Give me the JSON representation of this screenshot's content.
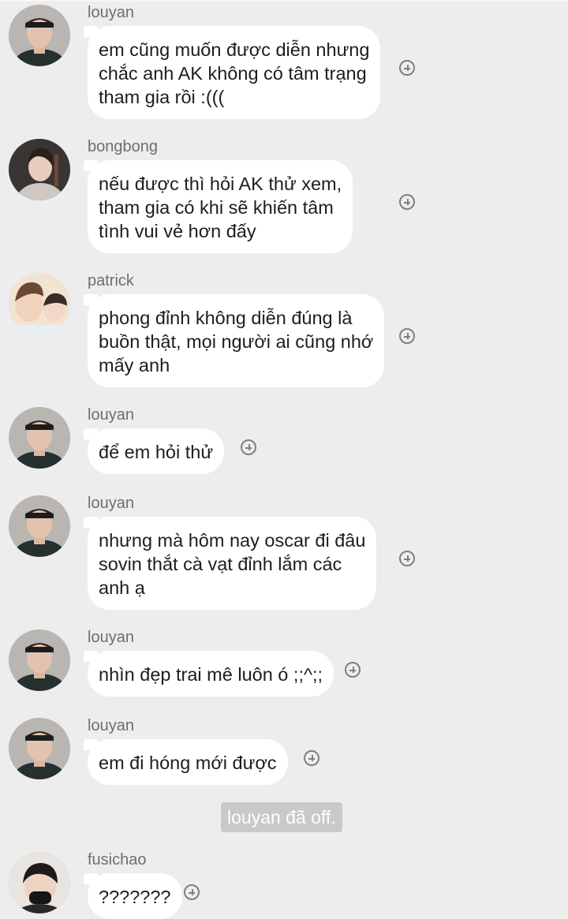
{
  "messages": [
    {
      "sender": "louyan",
      "avatar": "louyan-avatar",
      "text": "em cũng muốn được diễn nhưng\nchắc anh AK không có tâm trạng\ntham gia rồi :((("
    },
    {
      "sender": "bongbong",
      "avatar": "bongbong-avatar",
      "text": "nếu được thì hỏi AK thử xem,\ntham gia có khi sẽ khiến tâm\ntình vui vẻ hơn đấy"
    },
    {
      "sender": "patrick",
      "avatar": "patrick-avatar",
      "text": "phong đỉnh không diễn đúng là\nbuồn thật, mọi người ai cũng nhớ\nmấy anh"
    },
    {
      "sender": "louyan",
      "avatar": "louyan-avatar",
      "text": "để em hỏi thử"
    },
    {
      "sender": "louyan",
      "avatar": "louyan-avatar",
      "text": "nhưng mà hôm nay oscar đi đâu\nsovin thắt cà vạt đỉnh lắm các\nanh ạ"
    },
    {
      "sender": "louyan",
      "avatar": "louyan-avatar",
      "text": "nhìn đẹp trai mê luôn ó ;;^;;"
    },
    {
      "sender": "louyan",
      "avatar": "louyan-avatar",
      "text": "em đi hóng mới được"
    },
    {
      "sender": "fusichao",
      "avatar": "fusichao-avatar",
      "text": "???????"
    }
  ],
  "system_notice": "louyan đã off."
}
